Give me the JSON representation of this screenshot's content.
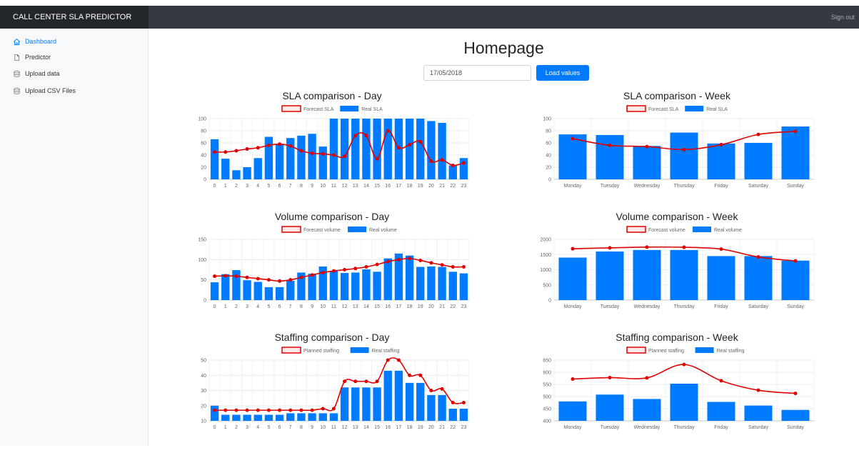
{
  "app": {
    "title": "CALL CENTER SLA PREDICTOR",
    "signout_label": "Sign out"
  },
  "sidebar": {
    "items": [
      {
        "label": "Dashboard",
        "icon": "home-icon",
        "active": true
      },
      {
        "label": "Predictor",
        "icon": "file-icon",
        "active": false
      },
      {
        "label": "Upload data",
        "icon": "database-icon",
        "active": false
      },
      {
        "label": "Upload CSV Files",
        "icon": "database-icon",
        "active": false
      }
    ]
  },
  "main": {
    "title": "Homepage",
    "date_value": "17/05/2018",
    "load_label": "Load values"
  },
  "colors": {
    "bar": "#007bff",
    "line": "#e00000",
    "topbar": "#343a40",
    "accent": "#007bff"
  },
  "chart_data": [
    {
      "title": "SLA comparison - Day",
      "type": "bar",
      "categories": [
        "0",
        "1",
        "2",
        "3",
        "4",
        "5",
        "6",
        "7",
        "8",
        "9",
        "10",
        "11",
        "12",
        "13",
        "14",
        "15",
        "16",
        "17",
        "18",
        "19",
        "20",
        "21",
        "22",
        "23"
      ],
      "series": [
        {
          "name": "Forecast SLA",
          "kind": "line",
          "values": [
            45,
            45,
            47,
            50,
            52,
            56,
            58,
            55,
            47,
            43,
            42,
            40,
            38,
            72,
            72,
            34,
            80,
            52,
            57,
            62,
            30,
            32,
            23,
            27
          ]
        },
        {
          "name": "Real SLA",
          "kind": "bar",
          "values": [
            66,
            34,
            15,
            20,
            35,
            70,
            58,
            68,
            72,
            75,
            54,
            100,
            100,
            100,
            100,
            100,
            100,
            100,
            100,
            100,
            96,
            93,
            23,
            35
          ]
        }
      ],
      "ylim": [
        0,
        100
      ],
      "yticks": [
        0,
        20,
        40,
        60,
        80,
        100
      ],
      "legend": "top"
    },
    {
      "title": "SLA comparison - Week",
      "type": "bar",
      "categories": [
        "Monday",
        "Tuesday",
        "Wednesday",
        "Thursday",
        "Friday",
        "Saturday",
        "Sunday"
      ],
      "series": [
        {
          "name": "Forecast SLA",
          "kind": "line",
          "values": [
            67,
            56,
            54,
            49,
            57,
            74,
            79
          ]
        },
        {
          "name": "Real SLA",
          "kind": "bar",
          "values": [
            74,
            73,
            55,
            77,
            59,
            60,
            87
          ]
        }
      ],
      "ylim": [
        0,
        100
      ],
      "yticks": [
        0,
        20,
        40,
        60,
        80,
        100
      ],
      "legend": "top"
    },
    {
      "title": "Volume comparison - Day",
      "type": "bar",
      "categories": [
        "0",
        "1",
        "2",
        "3",
        "4",
        "5",
        "6",
        "7",
        "8",
        "9",
        "10",
        "11",
        "12",
        "13",
        "14",
        "15",
        "16",
        "17",
        "18",
        "19",
        "20",
        "21",
        "22",
        "23"
      ],
      "series": [
        {
          "name": "Forecast volume",
          "kind": "line",
          "values": [
            59,
            60,
            59,
            56,
            53,
            50,
            47,
            50,
            56,
            62,
            68,
            72,
            75,
            78,
            82,
            88,
            95,
            100,
            103,
            98,
            92,
            87,
            82,
            82
          ]
        },
        {
          "name": "Real volume",
          "kind": "bar",
          "values": [
            44,
            64,
            74,
            49,
            45,
            32,
            32,
            48,
            68,
            65,
            83,
            72,
            67,
            68,
            76,
            70,
            103,
            115,
            110,
            82,
            83,
            82,
            70,
            66
          ]
        }
      ],
      "ylim": [
        0,
        150
      ],
      "yticks": [
        0,
        50,
        100,
        150
      ],
      "legend": "top"
    },
    {
      "title": "Volume comparison - Week",
      "type": "bar",
      "categories": [
        "Monday",
        "Tuesday",
        "Wednesday",
        "Thursday",
        "Friday",
        "Saturday",
        "Sunday"
      ],
      "series": [
        {
          "name": "Forecast volume",
          "kind": "line",
          "values": [
            1690,
            1720,
            1745,
            1740,
            1680,
            1420,
            1290
          ]
        },
        {
          "name": "Real volume",
          "kind": "bar",
          "values": [
            1400,
            1600,
            1650,
            1650,
            1450,
            1450,
            1300
          ]
        }
      ],
      "ylim": [
        0,
        2000
      ],
      "yticks": [
        0,
        500,
        1000,
        1500,
        2000
      ],
      "legend": "top"
    },
    {
      "title": "Staffing comparison - Day",
      "type": "bar",
      "categories": [
        "0",
        "1",
        "2",
        "3",
        "4",
        "5",
        "6",
        "7",
        "8",
        "9",
        "10",
        "11",
        "12",
        "13",
        "14",
        "15",
        "16",
        "17",
        "18",
        "19",
        "20",
        "21",
        "22",
        "23"
      ],
      "series": [
        {
          "name": "Planned staffing",
          "kind": "line",
          "values": [
            17,
            17,
            17,
            17,
            17,
            17,
            17,
            17,
            17,
            17,
            18,
            18,
            36,
            36,
            36,
            36,
            50,
            50,
            40,
            40,
            30,
            31,
            22,
            22
          ]
        },
        {
          "name": "Real staffing",
          "kind": "bar",
          "values": [
            20,
            14,
            14,
            14,
            14,
            14,
            14,
            15,
            15,
            15,
            15,
            15,
            32,
            32,
            32,
            32,
            43,
            43,
            35,
            35,
            27,
            27,
            18,
            18
          ]
        }
      ],
      "ylim": [
        10,
        50
      ],
      "yticks": [
        10,
        20,
        30,
        40,
        50
      ],
      "legend": "top"
    },
    {
      "title": "Staffing comparison - Week",
      "type": "bar",
      "categories": [
        "Monday",
        "Tuesday",
        "Wednesday",
        "Thursday",
        "Friday",
        "Saturday",
        "Sunday"
      ],
      "series": [
        {
          "name": "Planned staffing",
          "kind": "line",
          "values": [
            572,
            578,
            577,
            632,
            565,
            526,
            513
          ]
        },
        {
          "name": "Real staffing",
          "kind": "bar",
          "values": [
            480,
            508,
            490,
            553,
            478,
            463,
            445
          ]
        }
      ],
      "ylim": [
        400,
        650
      ],
      "yticks": [
        400,
        450,
        500,
        550,
        600,
        650
      ],
      "legend": "top"
    }
  ]
}
